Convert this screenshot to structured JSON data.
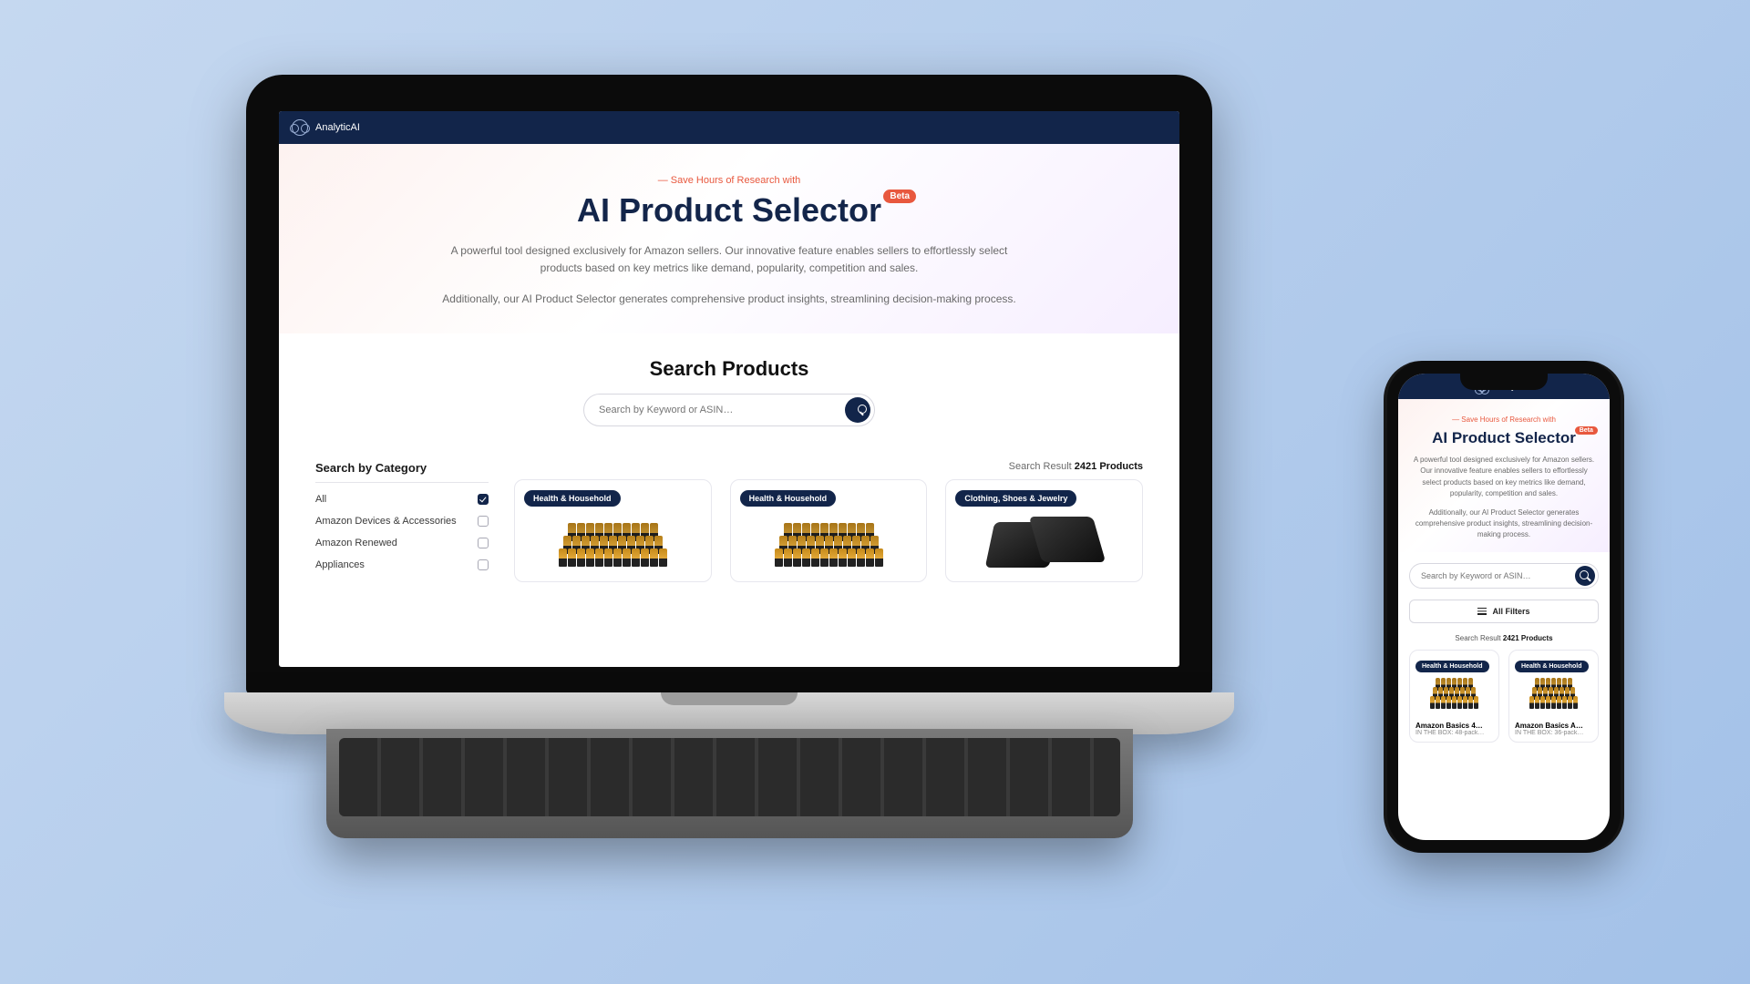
{
  "brand": "AnalyticAI",
  "hero": {
    "eyebrow": "—  Save Hours of Research with",
    "title": "AI Product Selector",
    "badge": "Beta",
    "desc1": "A powerful tool designed exclusively for Amazon sellers. Our innovative feature enables sellers to effortlessly select products based on key metrics like demand, popularity, competition and sales.",
    "desc2": "Additionally, our AI Product Selector generates comprehensive product insights, streamlining decision-making process."
  },
  "search": {
    "heading": "Search Products",
    "placeholder": "Search by Keyword or ASIN…"
  },
  "categories": {
    "title": "Search by Category",
    "items": [
      {
        "label": "All",
        "checked": true
      },
      {
        "label": "Amazon Devices & Accessories",
        "checked": false
      },
      {
        "label": "Amazon Renewed",
        "checked": false
      },
      {
        "label": "Appliances",
        "checked": false
      }
    ]
  },
  "results": {
    "prefix": "Search Result",
    "count": "2421 Products",
    "cards": [
      {
        "tag": "Health & Household",
        "kind": "batteries"
      },
      {
        "tag": "Health & Household",
        "kind": "batteries"
      },
      {
        "tag": "Clothing, Shoes & Jewelry",
        "kind": "wallet"
      }
    ]
  },
  "mobile": {
    "filters_label": "All Filters",
    "cards": [
      {
        "tag": "Health & Household",
        "title": "Amazon Basics 4…",
        "sub": "IN THE BOX: 48-pack…"
      },
      {
        "tag": "Health & Household",
        "title": "Amazon Basics A…",
        "sub": "IN THE BOX: 36-pack…"
      }
    ]
  }
}
